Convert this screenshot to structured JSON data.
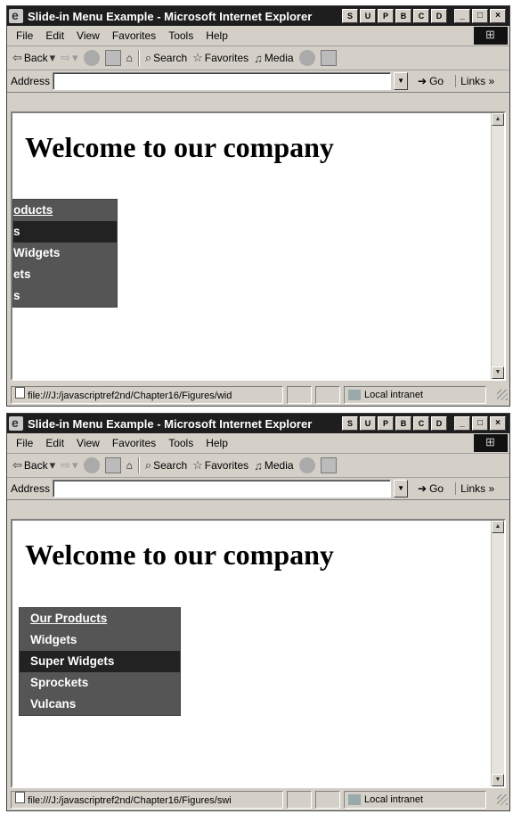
{
  "windows": [
    {
      "title": "Slide-in Menu Example - Microsoft Internet Explorer",
      "title_buttons": [
        "S",
        "U",
        "P",
        "B",
        "C",
        "D"
      ],
      "menubar": [
        "File",
        "Edit",
        "View",
        "Favorites",
        "Tools",
        "Help"
      ],
      "toolbar": {
        "back": "Back",
        "search": "Search",
        "favorites": "Favorites",
        "media": "Media"
      },
      "address": {
        "label": "Address",
        "value": "",
        "go": "Go",
        "links": "Links »"
      },
      "page": {
        "heading": "Welcome to our company",
        "menu_items": [
          "oducts",
          "s",
          "Widgets",
          "ets",
          "s"
        ],
        "active_index": 1
      },
      "status": {
        "url": "file:///J:/javascriptref2nd/Chapter16/Figures/wid",
        "zone": "Local intranet"
      }
    },
    {
      "title": "Slide-in Menu Example - Microsoft Internet Explorer",
      "title_buttons": [
        "S",
        "U",
        "P",
        "B",
        "C",
        "D"
      ],
      "menubar": [
        "File",
        "Edit",
        "View",
        "Favorites",
        "Tools",
        "Help"
      ],
      "toolbar": {
        "back": "Back",
        "search": "Search",
        "favorites": "Favorites",
        "media": "Media"
      },
      "address": {
        "label": "Address",
        "value": "",
        "go": "Go",
        "links": "Links »"
      },
      "page": {
        "heading": "Welcome to our company",
        "menu_items": [
          "Our Products",
          "Widgets",
          "Super Widgets",
          "Sprockets",
          "Vulcans"
        ],
        "active_index": 2
      },
      "status": {
        "url": "file:///J:/javascriptref2nd/Chapter16/Figures/swi",
        "zone": "Local intranet"
      }
    }
  ],
  "colors": {
    "menu_bg": "#555555",
    "menu_active": "#222222",
    "titlebar": "#1e1e1e"
  }
}
